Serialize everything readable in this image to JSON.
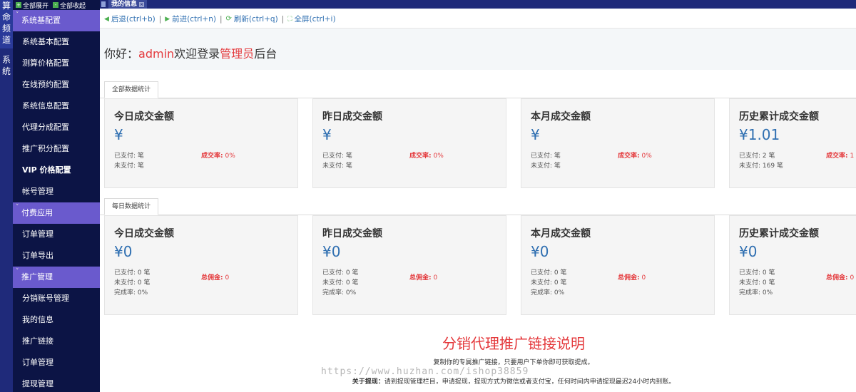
{
  "left_strip": {
    "channel_label": "算命频道",
    "system_label": "系统"
  },
  "sidebar": {
    "expand_all": "全部展开",
    "collapse_all": "全部收起",
    "items": [
      {
        "label": "系统基配置",
        "type": "group"
      },
      {
        "label": "系统基本配置",
        "type": "item"
      },
      {
        "label": "测算价格配置",
        "type": "item"
      },
      {
        "label": "在线预约配置",
        "type": "item"
      },
      {
        "label": "系统信息配置",
        "type": "item"
      },
      {
        "label": "代理分成配置",
        "type": "item"
      },
      {
        "label": "推广积分配置",
        "type": "item"
      },
      {
        "label": "VIP 价格配置",
        "type": "item"
      },
      {
        "label": "帐号管理",
        "type": "item"
      },
      {
        "label": "付费应用",
        "type": "group"
      },
      {
        "label": "订单管理",
        "type": "item"
      },
      {
        "label": "订单导出",
        "type": "item"
      },
      {
        "label": "推广管理",
        "type": "group"
      },
      {
        "label": "分销账号管理",
        "type": "item"
      },
      {
        "label": "我的信息",
        "type": "item"
      },
      {
        "label": "推广链接",
        "type": "item"
      },
      {
        "label": "订单管理",
        "type": "item"
      },
      {
        "label": "提现管理",
        "type": "item"
      }
    ]
  },
  "tabbar": {
    "active_tab": "我的信息"
  },
  "navbar": {
    "back": "后退(ctrl+b)",
    "forward": "前进(ctrl+n)",
    "refresh": "刷新(ctrl+q)",
    "fullscreen": "全屏(ctrl+i)"
  },
  "greeting": {
    "prefix": "你好：",
    "user": "admin",
    "middle": "欢迎登录",
    "role": "管理员",
    "suffix": "后台"
  },
  "all_stats": {
    "tab_label": "全部数据统计",
    "cards": [
      {
        "title": "今日成交金额",
        "amount": "¥",
        "paid": "已支付: 笔",
        "unpaid": "未支付: 笔",
        "rate_label": "成交率:",
        "rate_value": "0%"
      },
      {
        "title": "昨日成交金额",
        "amount": "¥",
        "paid": "已支付: 笔",
        "unpaid": "未支付: 笔",
        "rate_label": "成交率:",
        "rate_value": "0%"
      },
      {
        "title": "本月成交金额",
        "amount": "¥",
        "paid": "已支付: 笔",
        "unpaid": "未支付: 笔",
        "rate_label": "成交率:",
        "rate_value": "0%"
      },
      {
        "title": "历史累计成交金额",
        "amount": "¥1.01",
        "paid": "已支付: 2 笔",
        "unpaid": "未支付: 169 笔",
        "rate_label": "成交率:",
        "rate_value": "1"
      }
    ]
  },
  "daily_stats": {
    "tab_label": "每日数据统计",
    "cards": [
      {
        "title": "今日成交金额",
        "amount": "¥0",
        "paid": "已支付: 0 笔",
        "unpaid": "未支付: 0 笔",
        "done": "完成率: 0%",
        "rate_label": "总佣金:",
        "rate_value": "0"
      },
      {
        "title": "昨日成交金额",
        "amount": "¥0",
        "paid": "已支付: 0 笔",
        "unpaid": "未支付: 0 笔",
        "done": "完成率: 0%",
        "rate_label": "总佣金:",
        "rate_value": "0"
      },
      {
        "title": "本月成交金额",
        "amount": "¥0",
        "paid": "已支付: 0 笔",
        "unpaid": "未支付: 0 笔",
        "done": "完成率: 0%",
        "rate_label": "总佣金:",
        "rate_value": "0"
      },
      {
        "title": "历史累计成交金额",
        "amount": "¥0",
        "paid": "已支付: 0 笔",
        "unpaid": "未支付: 0 笔",
        "done": "完成率: 0%",
        "rate_label": "总佣金:",
        "rate_value": "0"
      }
    ]
  },
  "explanation": {
    "title": "分销代理推广链接说明",
    "line1": "复制你的专属推广链接，只要用户下单你即可获取提成。",
    "line2_label": "关于提现：",
    "line2_text": "请到提现管理栏目，申请提现，提现方式为微信或者支付宝，任何时间内申请提现最迟24小时内到账。",
    "watermark": "https://www.huzhan.com/ishop38859"
  },
  "colors": {
    "sidebar_bg": "#0c1445",
    "group_bg": "#6a5acd",
    "accent_blue": "#2f6fb1",
    "accent_red": "#e4393c"
  }
}
